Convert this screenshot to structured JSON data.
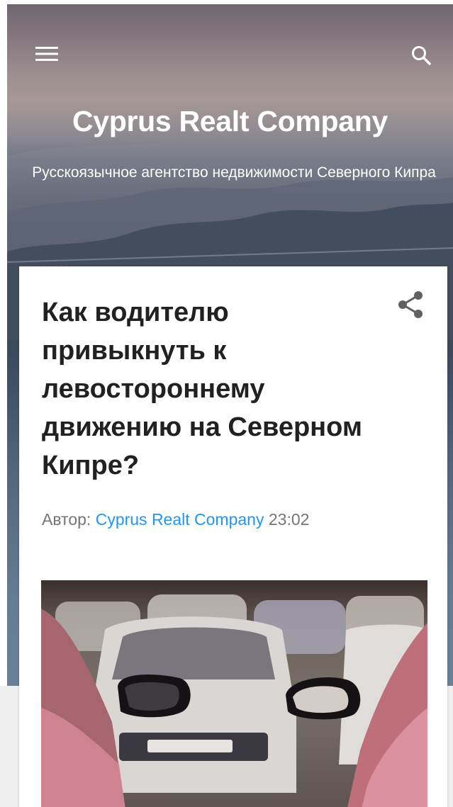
{
  "header": {
    "blog_title": "Cyprus Realt Company",
    "blog_description": "Русскоязычное агентство недвижимости Северного Кипра",
    "menu_icon": "hamburger-menu-icon",
    "search_icon": "search-icon"
  },
  "post": {
    "title": "Как водителю привыкнуть к левостороннему движению на Северном Кипре?",
    "share_icon": "share-icon",
    "byline": {
      "author_prefix": "Автор:",
      "author_name": "Cyprus Realt Company",
      "time": "23:02"
    },
    "image_alt": "traffic-cars-photo"
  },
  "colors": {
    "link": "#2196f3",
    "title_text": "#212121",
    "meta_text": "#757575",
    "page_bg": "#f0f0f0"
  }
}
